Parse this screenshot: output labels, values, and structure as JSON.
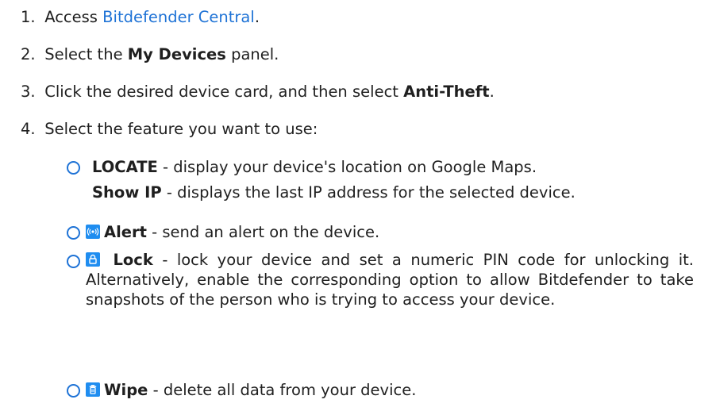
{
  "steps": [
    {
      "num": "1.",
      "prefix": "Access ",
      "link": "Bitdefender Central",
      "suffix": "."
    },
    {
      "num": "2.",
      "prefix": "Select the ",
      "bold": "My Devices",
      "suffix": " panel."
    },
    {
      "num": "3.",
      "prefix": "Click the desired device card, and then select ",
      "bold": "Anti-Theft",
      "suffix": "."
    },
    {
      "num": "4.",
      "text": "Select the feature you want to use:"
    }
  ],
  "features": {
    "locate": {
      "bold": "LOCATE",
      "text": " - display your device's location on Google Maps."
    },
    "show_ip": {
      "bold": "Show IP",
      "text": " - displays the last IP address for the selected device."
    },
    "alert": {
      "bold": "Alert",
      "text": " - send an alert on the device.",
      "icon": "alert-icon"
    },
    "lock": {
      "bold": "Lock",
      "text": " - lock your device and set a numeric PIN code for unlocking it. Alternatively, enable the corresponding option to allow Bitdefender to take snapshots of the person who is trying to access your device.",
      "icon": "lock-icon"
    },
    "wipe": {
      "bold": "Wipe",
      "text": " - delete all data from your device.",
      "icon": "trash-icon"
    }
  },
  "colors": {
    "link": "#1f73d6",
    "icon_bg": "#1f8df0"
  }
}
